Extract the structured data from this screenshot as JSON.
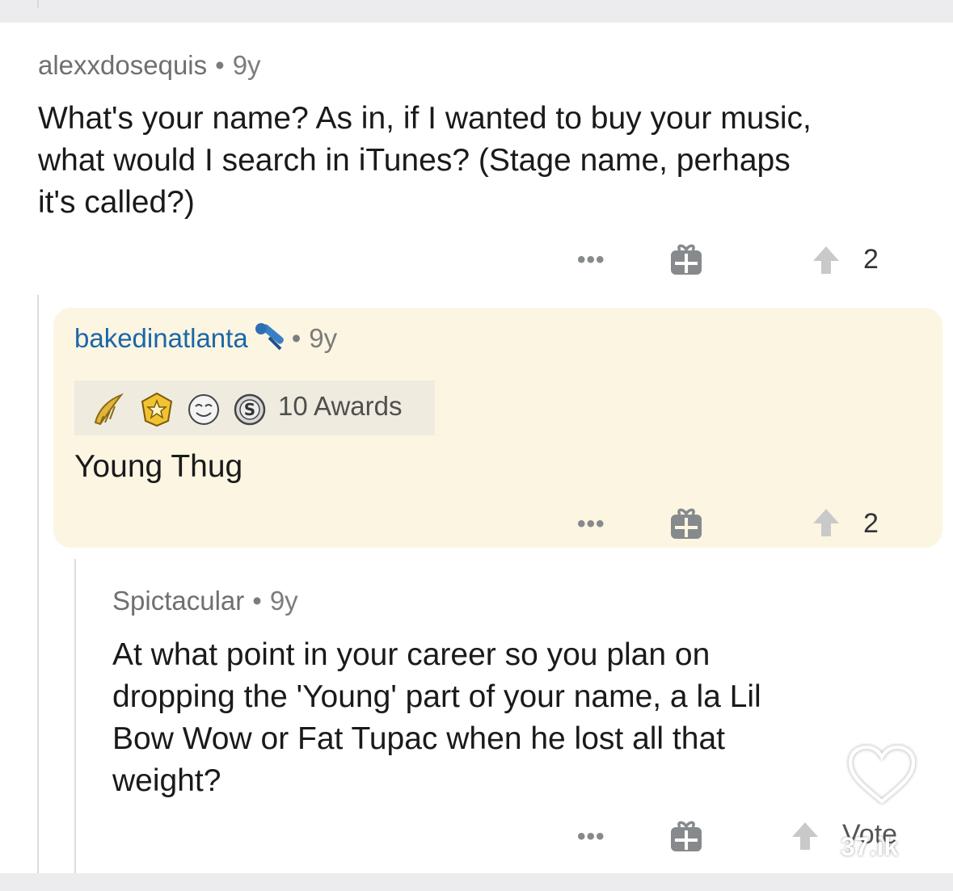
{
  "comments": [
    {
      "username": "alexxdosequis",
      "separator": "•",
      "age": "9y",
      "text": "What's your name? As in, if I wanted to buy your music, what would I search in iTunes? (Stage name, perhaps it's called?)",
      "lines": [
        "What's your name? As in, if I wanted to buy your music,",
        "what would I search in iTunes? (Stage name, perhaps",
        "it's called?)"
      ],
      "score": "2"
    },
    {
      "username": "bakedinatlanta",
      "flair_icon": "microphone-icon",
      "separator": "•",
      "age": "9y",
      "awards": {
        "icons": [
          "gold-wings-award-icon",
          "star-badge-award-icon",
          "face-award-icon",
          "silver-coin-award-icon"
        ],
        "label": "10 Awards"
      },
      "text": "Young Thug",
      "score": "2",
      "highlighted": true
    },
    {
      "username": "Spictacular",
      "separator": "•",
      "age": "9y",
      "lines": [
        "At what point in your career so you plan on",
        "dropping the 'Young' part of your name, a la Lil",
        "Bow Wow or Fat Tupac when he lost all that",
        "weight?"
      ],
      "score_label": "Vote"
    }
  ],
  "watermark": {
    "icon": "heart-outline-icon",
    "text": "37.ik"
  },
  "colors": {
    "highlight_bg": "#fbf5e2",
    "op_username": "#1a67a7",
    "meta_gray": "#7c7c7c",
    "icon_gray": "#878a8c"
  }
}
